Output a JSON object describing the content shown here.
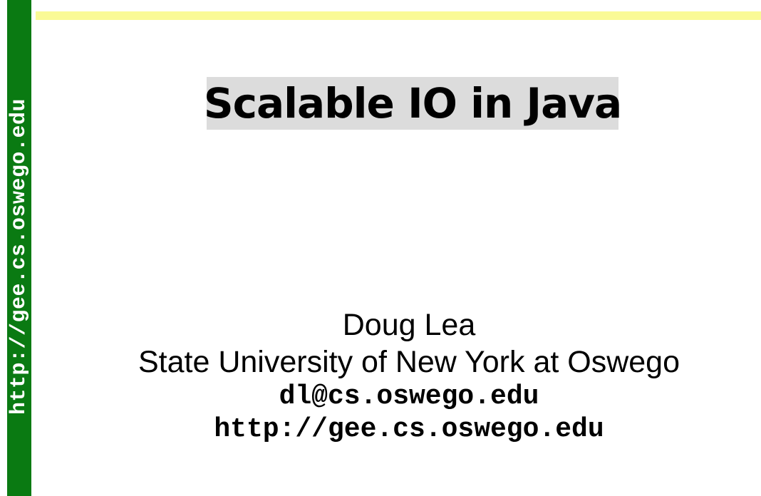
{
  "sidebar": {
    "url_text": "http://gee.cs.oswego.edu"
  },
  "slide": {
    "title": "Scalable IO in Java",
    "author": "Doug Lea",
    "affiliation": "State University of New York at Oswego",
    "email": "dl@cs.oswego.edu",
    "url": "http://gee.cs.oswego.edu"
  },
  "colors": {
    "sidebar": "#0a7a12",
    "top_rule": "#fafa96",
    "title_highlight": "#dcdcdc"
  }
}
